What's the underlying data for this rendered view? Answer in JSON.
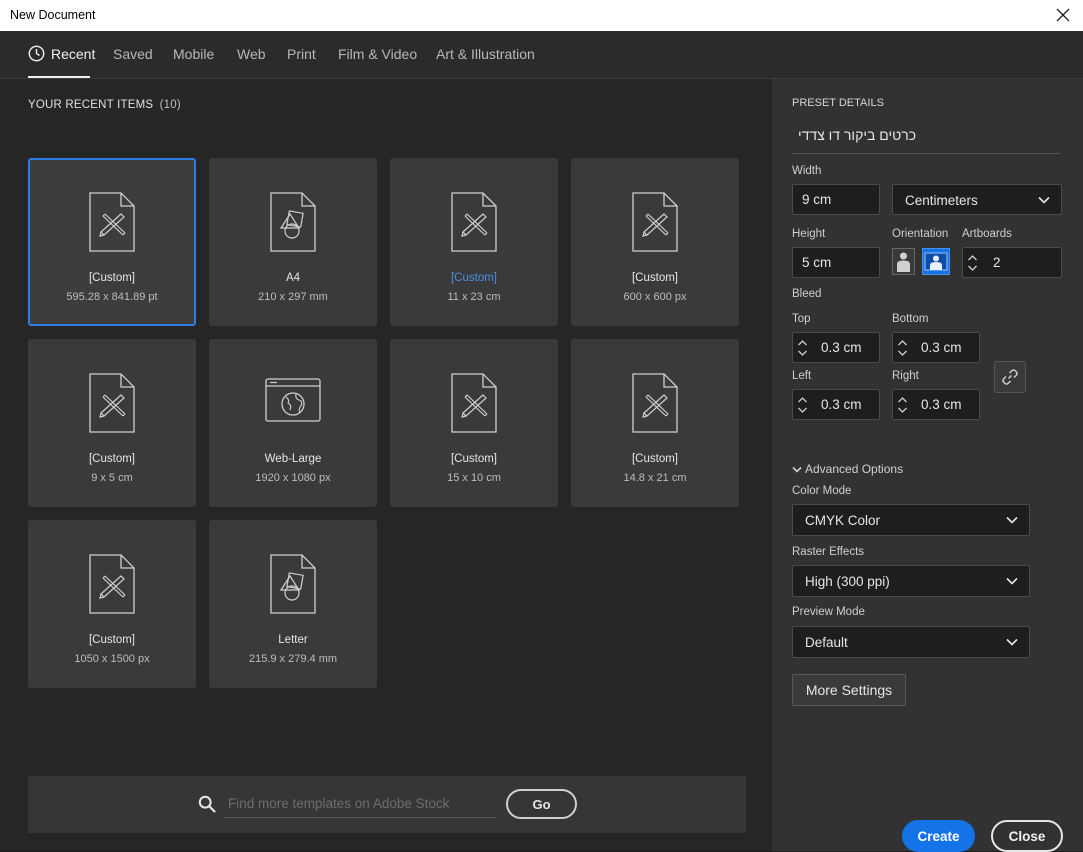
{
  "window": {
    "title": "New Document"
  },
  "tabs": [
    {
      "label": "Recent",
      "active": true
    },
    {
      "label": "Saved"
    },
    {
      "label": "Mobile"
    },
    {
      "label": "Web"
    },
    {
      "label": "Print"
    },
    {
      "label": "Film & Video"
    },
    {
      "label": "Art & Illustration"
    }
  ],
  "recent": {
    "heading": "YOUR RECENT ITEMS",
    "count": "(10)",
    "items": [
      {
        "name": "[Custom]",
        "dims": "595.28 x 841.89 pt",
        "icon": "illustration-doc-icon"
      },
      {
        "name": "A4",
        "dims": "210 x 297 mm",
        "icon": "shapes-doc-icon"
      },
      {
        "name": "[Custom]",
        "dims": "11 x 23 cm",
        "icon": "illustration-doc-icon"
      },
      {
        "name": "[Custom]",
        "dims": "600 x 600 px",
        "icon": "illustration-doc-icon"
      },
      {
        "name": "[Custom]",
        "dims": "9 x 5 cm",
        "icon": "illustration-doc-icon"
      },
      {
        "name": "Web-Large",
        "dims": "1920 x 1080 px",
        "icon": "web-globe-icon"
      },
      {
        "name": "[Custom]",
        "dims": "15 x 10 cm",
        "icon": "illustration-doc-icon"
      },
      {
        "name": "[Custom]",
        "dims": "14.8 x 21 cm",
        "icon": "illustration-doc-icon"
      },
      {
        "name": "[Custom]",
        "dims": "1050 x 1500 px",
        "icon": "illustration-doc-icon"
      },
      {
        "name": "Letter",
        "dims": "215.9 x 279.4 mm",
        "icon": "shapes-doc-icon"
      }
    ]
  },
  "search": {
    "placeholder": "Find more templates on Adobe Stock",
    "go_label": "Go"
  },
  "preset": {
    "heading": "PRESET DETAILS",
    "name": "כרטים ביקור דו צדדי",
    "width_label": "Width",
    "width_value": "9 cm",
    "units_value": "Centimeters",
    "height_label": "Height",
    "height_value": "5 cm",
    "orientation_label": "Orientation",
    "artboards_label": "Artboards",
    "artboards_value": "2",
    "bleed_label": "Bleed",
    "top_label": "Top",
    "top_value": "0.3 cm",
    "bottom_label": "Bottom",
    "bottom_value": "0.3 cm",
    "left_label": "Left",
    "left_value": "0.3 cm",
    "right_label": "Right",
    "right_value": "0.3 cm",
    "advanced_label": "Advanced Options",
    "color_mode_label": "Color Mode",
    "color_mode_value": "CMYK Color",
    "raster_label": "Raster Effects",
    "raster_value": "High (300 ppi)",
    "preview_label": "Preview Mode",
    "preview_value": "Default",
    "more_settings": "More Settings",
    "create": "Create",
    "close": "Close"
  },
  "colors": {
    "accent": "#1473e6",
    "selected_border": "#2d7be8"
  }
}
